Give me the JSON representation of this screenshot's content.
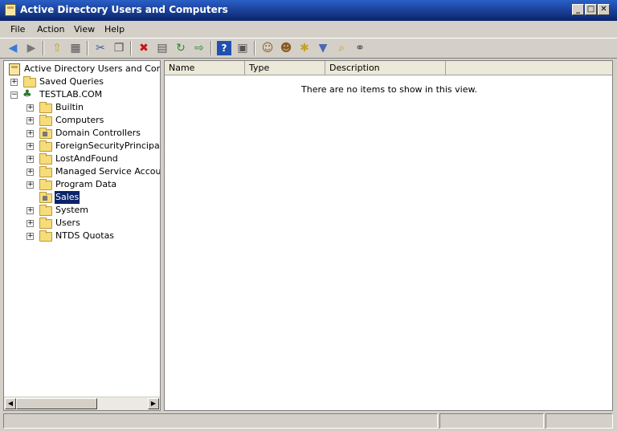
{
  "window": {
    "title": "Active Directory Users and Computers",
    "controls": [
      "minimize",
      "maximize",
      "close"
    ]
  },
  "menu": [
    "File",
    "Action",
    "View",
    "Help"
  ],
  "toolbar": {
    "icons": [
      "back-icon",
      "forward-icon",
      "up-folder-icon",
      "show-console-tree-icon",
      "cut-icon",
      "copy-icon",
      "delete-icon",
      "properties-icon",
      "refresh-icon",
      "export-list-icon",
      "help-icon",
      "show-action-pane-icon",
      "add-user-icon",
      "add-group-icon",
      "add-ou-icon",
      "filter-icon",
      "find-icon",
      "add-members-icon"
    ]
  },
  "tree": {
    "root": "Active Directory Users and Comput",
    "saved_queries": "Saved Queries",
    "domain": "TESTLAB.COM",
    "children": [
      {
        "label": "Builtin",
        "expandable": true,
        "ou": false
      },
      {
        "label": "Computers",
        "expandable": true,
        "ou": false
      },
      {
        "label": "Domain Controllers",
        "expandable": true,
        "ou": true
      },
      {
        "label": "ForeignSecurityPrincipals",
        "expandable": true,
        "ou": false
      },
      {
        "label": "LostAndFound",
        "expandable": true,
        "ou": false
      },
      {
        "label": "Managed Service Accounts",
        "expandable": true,
        "ou": false
      },
      {
        "label": "Program Data",
        "expandable": true,
        "ou": false
      },
      {
        "label": "Sales",
        "expandable": false,
        "ou": true,
        "selected": true
      },
      {
        "label": "System",
        "expandable": true,
        "ou": false
      },
      {
        "label": "Users",
        "expandable": true,
        "ou": false
      },
      {
        "label": "NTDS Quotas",
        "expandable": true,
        "ou": false
      }
    ]
  },
  "list": {
    "columns": [
      "Name",
      "Type",
      "Description"
    ],
    "empty_message": "There are no items to show in this view."
  },
  "colors": {
    "title_bar": "#0a246a",
    "selection": "#0a246a",
    "folder": "#f7dc7a"
  }
}
